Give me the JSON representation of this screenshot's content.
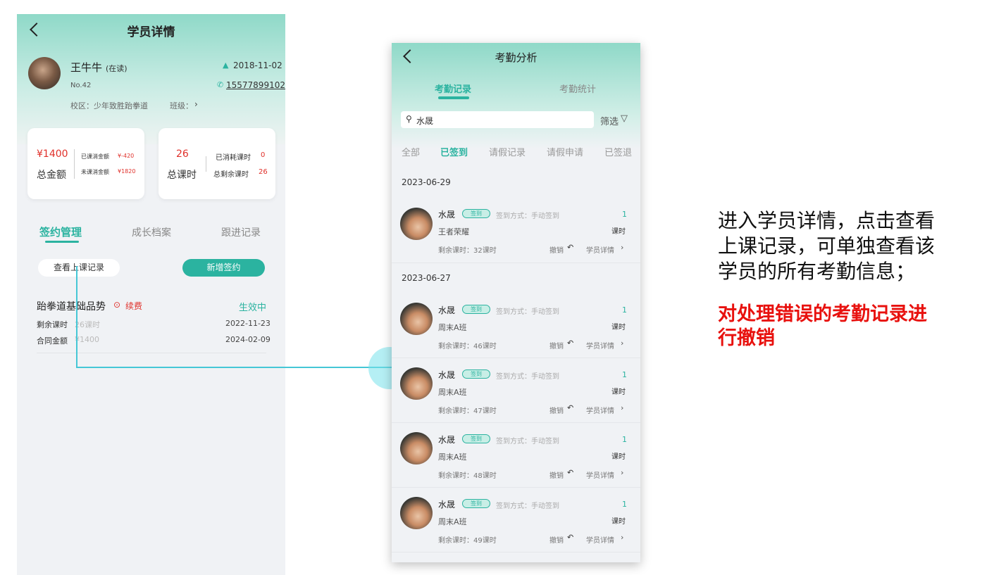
{
  "left": {
    "title": "学员详情",
    "student": {
      "name": "王牛牛",
      "status": "(在读)",
      "number": "No.42",
      "date": "2018-11-02",
      "phone": "15577899102",
      "campus": "校区：少年致胜跆拳道",
      "class_label": "班级："
    },
    "money_card": {
      "amount": "¥1400",
      "label": "总金额",
      "consumed_label": "已课消金额",
      "consumed_value": "¥-420",
      "unconsumed_label": "未课消金额",
      "unconsumed_value": "¥1820"
    },
    "hours_card": {
      "amount": "26",
      "label": "总课时",
      "used_label": "已消耗课时",
      "used_value": "0",
      "remaining_label": "总剩余课时",
      "remaining_value": "26"
    },
    "tabs": [
      "签约管理",
      "成长档案",
      "跟进记录"
    ],
    "view_records_button": "查看上课记录",
    "new_contract_button": "新增签约",
    "contract": {
      "name": "跆拳道基础品势",
      "renew": "续费",
      "status": "生效中",
      "remaining_label": "剩余课时",
      "remaining_value": "26课时",
      "start_date": "2022-11-23",
      "amount_label": "合同金额",
      "amount_value": "¥1400",
      "end_date": "2024-02-09"
    }
  },
  "right": {
    "title": "考勤分析",
    "tabs": [
      "考勤记录",
      "考勤统计"
    ],
    "search_value": "水晟",
    "filter_label": "筛选",
    "sub_tabs": [
      "全部",
      "已签到",
      "请假记录",
      "请假申请",
      "已签退"
    ],
    "groups": [
      {
        "date": "2023-06-29",
        "records": [
          {
            "name": "水晟",
            "badge": "签到",
            "method": "签到方式：手动签到",
            "class": "王者荣耀",
            "remaining": "剩余课时：32课时",
            "count": "1",
            "unit": "课时",
            "revoke": "撤销",
            "detail": "学员详情"
          }
        ]
      },
      {
        "date": "2023-06-27",
        "records": [
          {
            "name": "水晟",
            "badge": "签到",
            "method": "签到方式：手动签到",
            "class": "周末A班",
            "remaining": "剩余课时：46课时",
            "count": "1",
            "unit": "课时",
            "revoke": "撤销",
            "detail": "学员详情"
          },
          {
            "name": "水晟",
            "badge": "签到",
            "method": "签到方式：手动签到",
            "class": "周末A班",
            "remaining": "剩余课时：47课时",
            "count": "1",
            "unit": "课时",
            "revoke": "撤销",
            "detail": "学员详情"
          },
          {
            "name": "水晟",
            "badge": "签到",
            "method": "签到方式：手动签到",
            "class": "周末A班",
            "remaining": "剩余课时：48课时",
            "count": "1",
            "unit": "课时",
            "revoke": "撤销",
            "detail": "学员详情"
          },
          {
            "name": "水晟",
            "badge": "签到",
            "method": "签到方式：手动签到",
            "class": "周末A班",
            "remaining": "剩余课时：49课时",
            "count": "1",
            "unit": "课时",
            "revoke": "撤销",
            "detail": "学员详情"
          }
        ]
      }
    ]
  },
  "annotation": {
    "line1": "进入学员详情，点击查看",
    "line2": "上课记录，可单独查看该",
    "line3": "学员的所有考勤信息；",
    "red_line1": "对处理错误的考勤记录进",
    "red_line2": "行撤销"
  },
  "colors": {
    "accent": "#2bb3a0",
    "red": "#e0302a"
  }
}
